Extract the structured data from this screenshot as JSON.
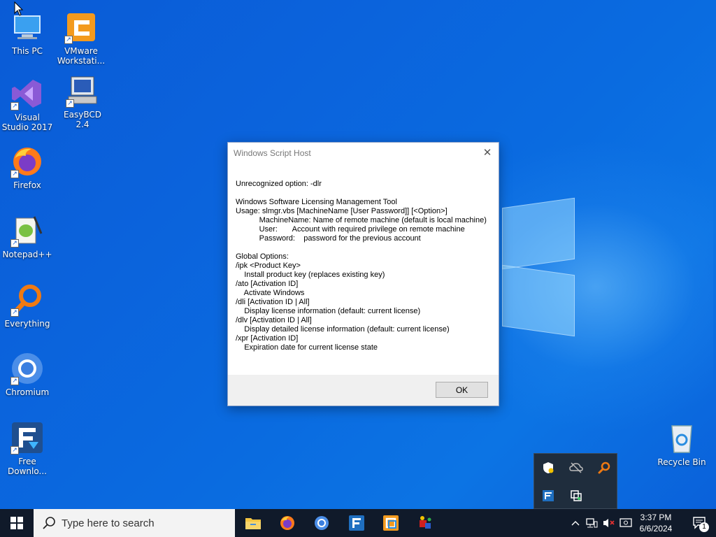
{
  "desktop": {
    "icons": [
      {
        "label": "This PC"
      },
      {
        "label": "VMware Workstati..."
      },
      {
        "label": "Visual Studio 2017"
      },
      {
        "label": "EasyBCD 2.4"
      },
      {
        "label": "Firefox"
      },
      {
        "label": "Notepad++"
      },
      {
        "label": "Everything"
      },
      {
        "label": "Chromium"
      },
      {
        "label": "Free Downlo..."
      },
      {
        "label": "Recycle Bin"
      }
    ]
  },
  "dialog": {
    "title": "Windows Script Host",
    "close_glyph": "✕",
    "lines": [
      "Unrecognized option: -dlr",
      "",
      "Windows Software Licensing Management Tool",
      "Usage: slmgr.vbs [MachineName [User Password]] [<Option>]",
      "           MachineName: Name of remote machine (default is local machine)",
      "           User:       Account with required privilege on remote machine",
      "           Password:    password for the previous account",
      "",
      "Global Options:",
      "/ipk <Product Key>",
      "    Install product key (replaces existing key)",
      "/ato [Activation ID]",
      "    Activate Windows",
      "/dli [Activation ID | All]",
      "    Display license information (default: current license)",
      "/dlv [Activation ID | All]",
      "    Display detailed license information (default: current license)",
      "/xpr [Activation ID]",
      "    Expiration date for current license state"
    ],
    "ok_label": "OK"
  },
  "taskbar": {
    "search_placeholder": "Type here to search",
    "time": "3:37 PM",
    "date": "6/6/2024",
    "notification_count": "1"
  },
  "colors": {
    "taskbar_bg": "#101a2a",
    "desktop_blue": "#0b63dc",
    "dialog_footer": "#f0f0f0"
  }
}
